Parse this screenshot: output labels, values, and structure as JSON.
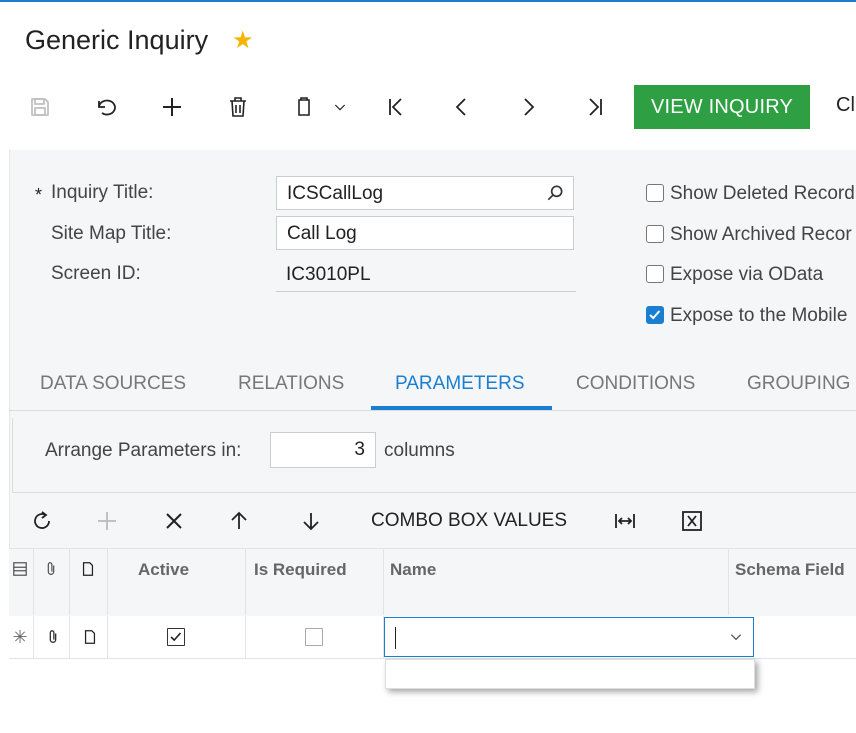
{
  "page": {
    "title": "Generic Inquiry",
    "favorite_icon": "star-icon"
  },
  "toolbar": {
    "save": "save-icon",
    "undo": "undo-icon",
    "add": "plus-icon",
    "delete": "trash-icon",
    "copy_paste": "clipboard-icon",
    "first": "first-record-icon",
    "prev": "previous-icon",
    "next": "next-icon",
    "last": "last-record-icon",
    "view_inquiry": "VIEW INQUIRY",
    "next_label": "Cl"
  },
  "form": {
    "inquiry_title_label": "Inquiry Title:",
    "required_mark": "*",
    "inquiry_title_value": "ICSCallLog",
    "site_map_title_label": "Site Map Title:",
    "site_map_title_value": "Call Log",
    "screen_id_label": "Screen ID:",
    "screen_id_value": "IC3010PL",
    "options": [
      {
        "label": "Show Deleted Record",
        "checked": false
      },
      {
        "label": "Show Archived Recor",
        "checked": false
      },
      {
        "label": "Expose via OData",
        "checked": false
      },
      {
        "label": "Expose to the Mobile",
        "checked": true
      }
    ]
  },
  "tabs": [
    "DATA SOURCES",
    "RELATIONS",
    "PARAMETERS",
    "CONDITIONS",
    "GROUPING"
  ],
  "active_tab": "PARAMETERS",
  "arrange": {
    "label": "Arrange Parameters in:",
    "value": "3",
    "unit": "columns"
  },
  "grid_toolbar": {
    "combo_box_values": "COMBO BOX VALUES"
  },
  "grid": {
    "headers": {
      "active": "Active",
      "is_required": "Is Required",
      "name": "Name",
      "schema_field": "Schema Field"
    },
    "new_row": {
      "active": true,
      "is_required": false,
      "name": ""
    }
  },
  "colors": {
    "accent": "#1b7fd1",
    "primary_button": "#2ea043",
    "star": "#f4b400"
  }
}
